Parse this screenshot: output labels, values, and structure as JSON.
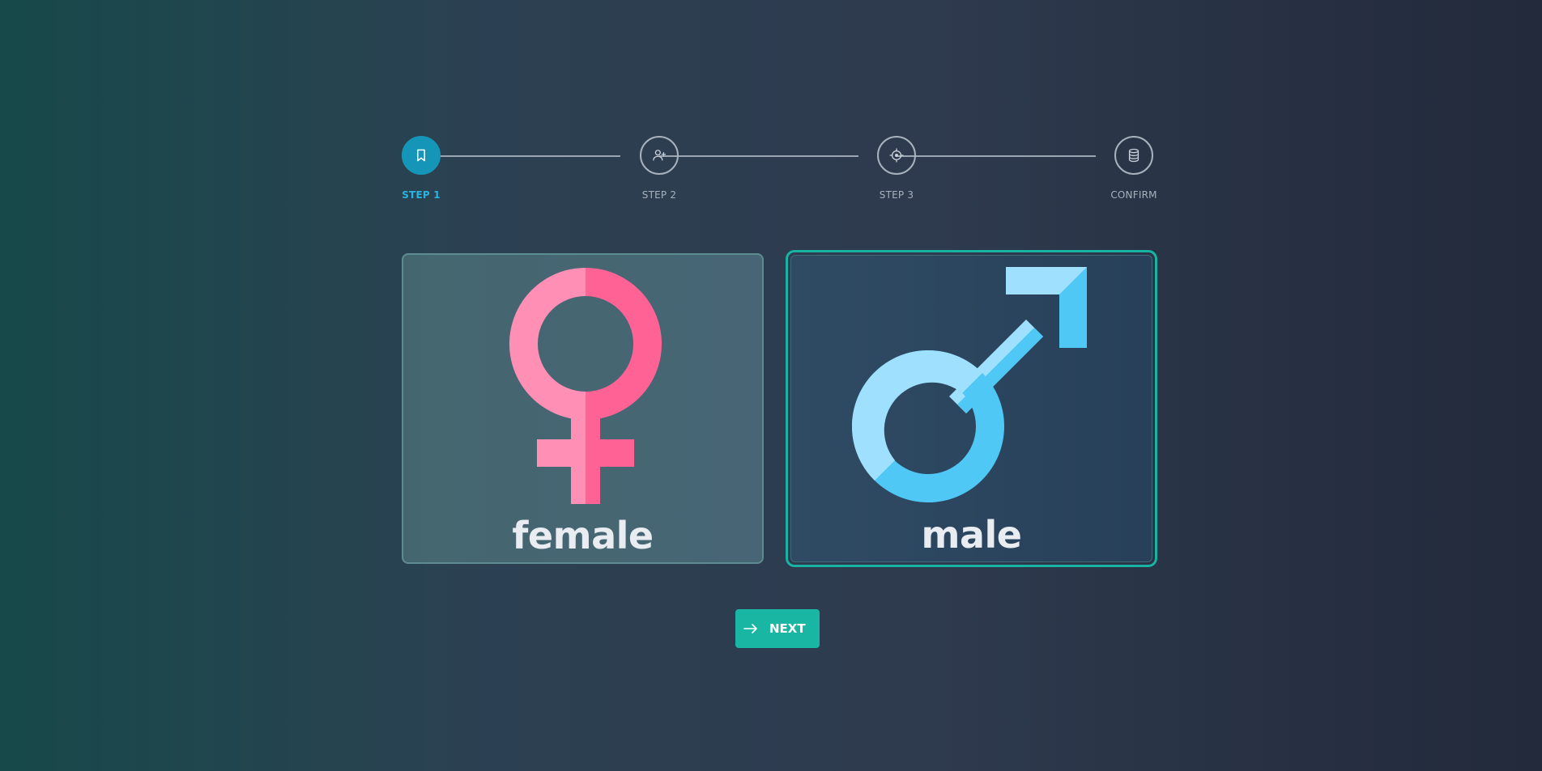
{
  "stepper": {
    "steps": [
      {
        "label": "STEP 1",
        "icon": "bookmark-icon",
        "active": true
      },
      {
        "label": "STEP 2",
        "icon": "user-add-icon",
        "active": false
      },
      {
        "label": "STEP 3",
        "icon": "crosshair-icon",
        "active": false
      },
      {
        "label": "CONFIRM",
        "icon": "database-icon",
        "active": false
      }
    ]
  },
  "options": {
    "female": {
      "label": "female",
      "icon": "female-symbol-icon",
      "selected": false
    },
    "male": {
      "label": "male",
      "icon": "male-symbol-icon",
      "selected": true
    }
  },
  "actions": {
    "next_label": "NEXT",
    "next_icon": "arrow-right-icon"
  },
  "colors": {
    "accent": "#18b6a3",
    "active_step": "#1596b8",
    "female_pink": "#ff6e9e",
    "male_blue": "#4fc8f5"
  }
}
